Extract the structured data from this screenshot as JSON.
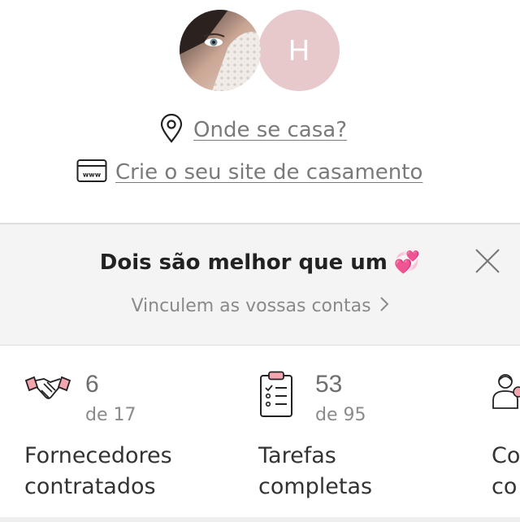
{
  "profile": {
    "partner_initial": "H"
  },
  "links": {
    "location": "Onde se casa?",
    "website": "Crie o seu site de casamento",
    "website_icon_text": "www"
  },
  "banner": {
    "title": "Dois são melhor que um",
    "title_emoji": "💞",
    "link": "Vinculem as vossas contas"
  },
  "stats": [
    {
      "icon": "handshake-icon",
      "value": "6",
      "total": "de 17",
      "label_line1": "Fornecedores",
      "label_line2": "contratados"
    },
    {
      "icon": "checklist-icon",
      "value": "53",
      "total": "de 95",
      "label_line1": "Tarefas",
      "label_line2": "completas"
    },
    {
      "icon": "guests-icon",
      "label_line1": "Co",
      "label_line2": "co"
    }
  ],
  "colors": {
    "partner_avatar_bg": "#e8c9cb",
    "banner_bg": "#f4f4f4",
    "accent_pink": "#f4a6b0"
  }
}
